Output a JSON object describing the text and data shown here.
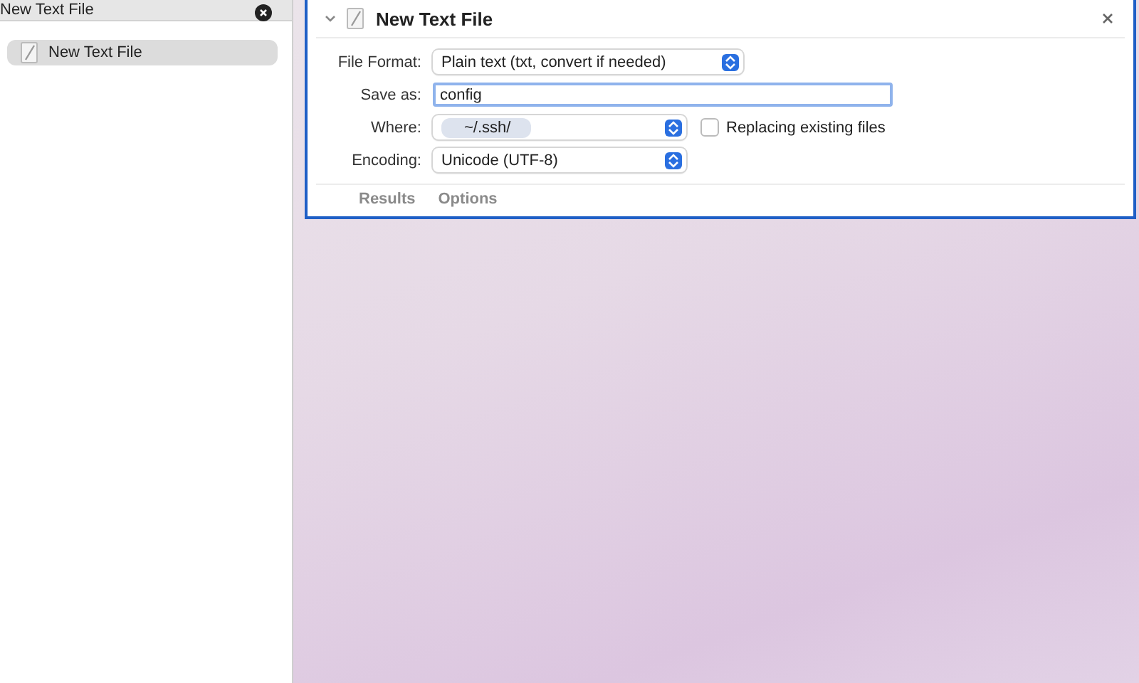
{
  "sidebar": {
    "search": {
      "value": "New Text File"
    },
    "items": [
      {
        "label": "New Text File",
        "selected": true
      }
    ]
  },
  "action": {
    "title": "New Text File",
    "expanded": true,
    "fields": [
      {
        "kind": "select",
        "label": "File Format:",
        "value": "Plain text (txt, convert if needed)"
      },
      {
        "kind": "text",
        "label": "Save as:",
        "value": "config"
      },
      {
        "kind": "path",
        "label": "Where:",
        "value": "~/.ssh/",
        "option": {
          "label": "Replacing existing files",
          "checked": false
        }
      },
      {
        "kind": "select",
        "label": "Encoding:",
        "value": "Unicode (UTF-8)"
      }
    ],
    "tabs": [
      {
        "label": "Results",
        "selected": false
      },
      {
        "label": "Options",
        "selected": false
      }
    ]
  }
}
